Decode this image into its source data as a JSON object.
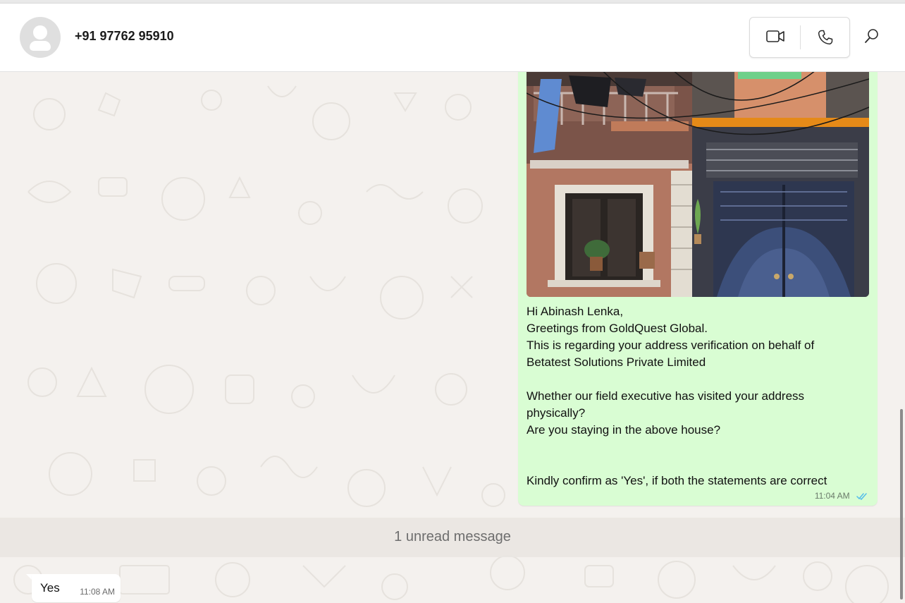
{
  "header": {
    "contact_name": "+91 97762 95910",
    "avatar_icon": "default-avatar-icon",
    "video_call_icon": "video-camera-icon",
    "voice_call_icon": "phone-icon",
    "search_icon": "search-icon"
  },
  "messages": [
    {
      "direction": "outgoing",
      "media": "house-photo",
      "lines": [
        "Hi Abinash Lenka,",
        "Greetings from GoldQuest Global.",
        "This is regarding your address verification on behalf of",
        "Betatest Solutions Private Limited",
        "",
        "Whether our field executive has visited your address",
        "physically?",
        "Are you staying in the above house?",
        "",
        "",
        "Kindly confirm as 'Yes', if both the statements are correct"
      ],
      "time": "11:04 AM",
      "status_icon": "double-check-icon"
    },
    {
      "direction": "incoming",
      "text": "Yes",
      "time": "11:08 AM"
    }
  ],
  "unread_divider": "1 unread message",
  "colors": {
    "outgoing_bubble": "#d9fdd3",
    "incoming_bubble": "#ffffff",
    "chat_background": "#f4f1ee",
    "read_ticks": "#53bdeb"
  }
}
